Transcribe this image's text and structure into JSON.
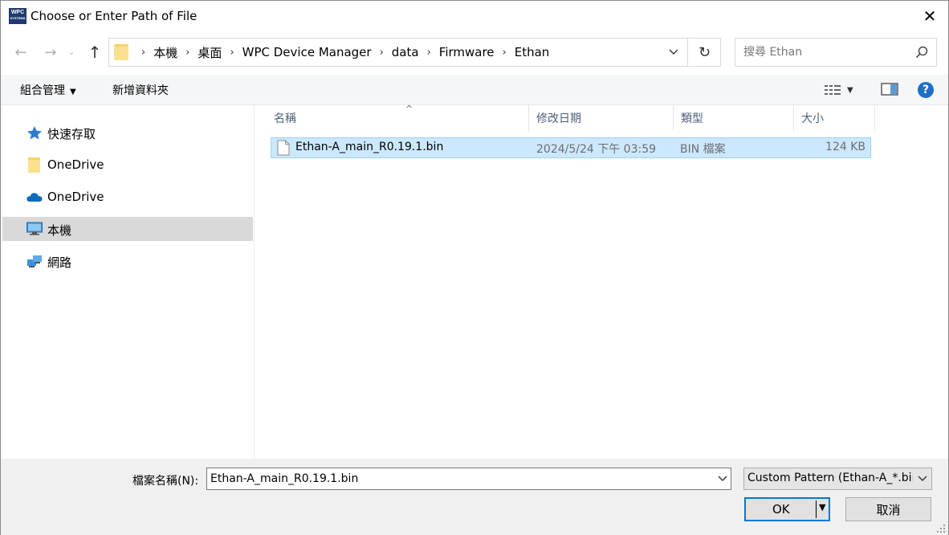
{
  "window": {
    "title": "Choose or Enter Path of File",
    "app_icon_text": [
      "WPC",
      "SYSTEMS"
    ],
    "close_glyph": "✕"
  },
  "nav": {
    "back_glyph": "←",
    "forward_glyph": "→",
    "recent_glyph": "⌄",
    "up_glyph": "↑",
    "refresh_glyph": "↻"
  },
  "address": {
    "crumbs": [
      "本機",
      "桌面",
      "WPC Device Manager",
      "data",
      "Firmware",
      "Ethan"
    ],
    "separator": "›"
  },
  "search": {
    "placeholder": "搜尋 Ethan"
  },
  "toolbar": {
    "organize_label": "組合管理",
    "new_folder_label": "新增資料夾",
    "help_glyph": "?"
  },
  "sidebar": {
    "items": [
      {
        "label": "快速存取",
        "icon": "star-icon",
        "selected": false
      },
      {
        "label": "OneDrive",
        "icon": "folder-icon",
        "selected": false
      },
      {
        "label": "OneDrive",
        "icon": "cloud-icon",
        "selected": false
      },
      {
        "label": "本機",
        "icon": "computer-icon",
        "selected": true
      },
      {
        "label": "網路",
        "icon": "network-icon",
        "selected": false
      }
    ]
  },
  "filelist": {
    "columns": [
      "名稱",
      "修改日期",
      "類型",
      "大小"
    ],
    "sort_glyph": "^",
    "rows": [
      {
        "name": "Ethan-A_main_R0.19.1.bin",
        "date": "2024/5/24 下午 03:59",
        "type": "BIN 檔案",
        "size": "124 KB"
      }
    ]
  },
  "footer": {
    "filename_label": "檔案名稱(N):",
    "filename_value": "Ethan-A_main_R0.19.1.bin",
    "filter_value": "Custom Pattern (Ethan-A_*.bin)",
    "ok_label": "OK",
    "cancel_label": "取消"
  },
  "colors": {
    "selection_bg": "#cce8ff",
    "selection_border": "#99d1ff",
    "accent": "#0078d7",
    "header_text": "#4c607a"
  }
}
